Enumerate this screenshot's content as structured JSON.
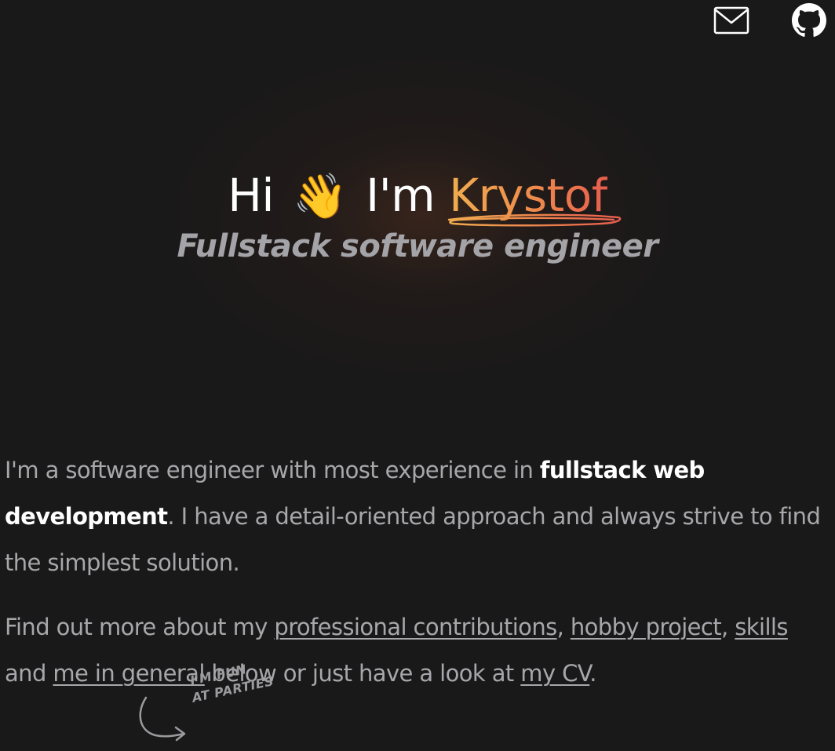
{
  "nav": {
    "mail_icon": "envelope-icon",
    "github_icon": "github-icon"
  },
  "hero": {
    "greeting": "Hi",
    "wave_emoji": "👋",
    "intro": "I'm",
    "name": "Krystof",
    "subtitle": "Fullstack software engineer",
    "name_gradient": [
      "#f0ad4e",
      "#e85d4d"
    ]
  },
  "about": {
    "p1_part1": "I'm a software engineer with most experience in ",
    "p1_bold": "fullstack web development",
    "p1_part2": ". I have a detail-oriented approach and always strive to find the simplest solution.",
    "p2_part1": "Find out more about my ",
    "link_contributions": "professional contributions",
    "comma1": ", ",
    "link_hobby": "hobby project",
    "comma2": ", ",
    "link_skills": "skills",
    "and": " and ",
    "link_general": "me in general",
    "p2_part2": " below or just have a look at ",
    "link_cv": "my CV",
    "period": "."
  },
  "doodle": {
    "line1": "I'M FUN",
    "line2": "AT PARTIES"
  }
}
